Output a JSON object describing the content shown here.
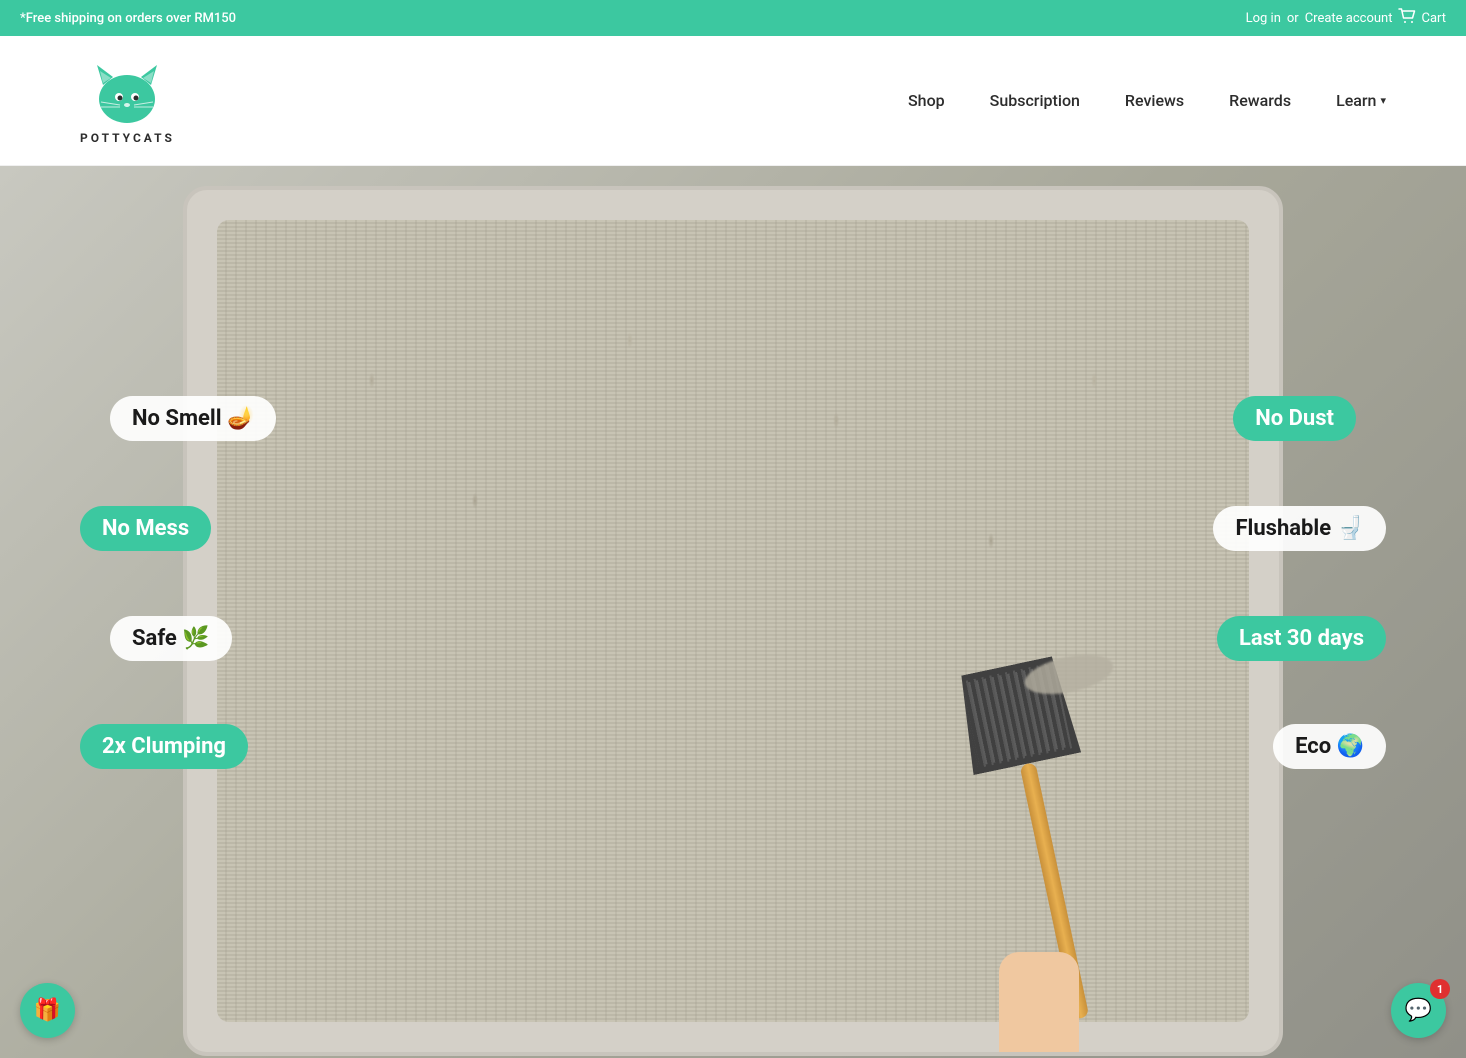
{
  "announcement": {
    "text": "*Free shipping on orders over RM150",
    "login": "Log in",
    "or": "or",
    "create_account": "Create account",
    "cart": "Cart"
  },
  "header": {
    "brand": "POTTYCATS",
    "nav": {
      "shop": "Shop",
      "subscription": "Subscription",
      "reviews": "Reviews",
      "rewards": "Rewards",
      "learn": "Learn"
    }
  },
  "hero": {
    "features": [
      {
        "id": "no-smell",
        "label": "No Smell",
        "emoji": "🪔",
        "style": "white",
        "position": "top-left"
      },
      {
        "id": "no-dust",
        "label": "No Dust",
        "emoji": "",
        "style": "teal",
        "position": "top-right"
      },
      {
        "id": "no-mess",
        "label": "No Mess",
        "emoji": "",
        "style": "teal",
        "position": "mid-left"
      },
      {
        "id": "flushable",
        "label": "Flushable",
        "emoji": "🚽",
        "style": "white",
        "position": "mid-right"
      },
      {
        "id": "safe",
        "label": "Safe",
        "emoji": "🌿",
        "style": "white",
        "position": "lower-left"
      },
      {
        "id": "last30",
        "label": "Last 30 days",
        "emoji": "",
        "style": "teal",
        "position": "lower-right"
      },
      {
        "id": "2xclumping",
        "label": "2x Clumping",
        "emoji": "",
        "style": "teal",
        "position": "bottom-left"
      },
      {
        "id": "eco",
        "label": "Eco",
        "emoji": "🌍",
        "style": "white",
        "position": "bottom-right"
      }
    ]
  },
  "widgets": {
    "rewards_icon": "🎁",
    "chat_icon": "💬",
    "chat_badge": "1"
  },
  "colors": {
    "teal": "#3cc8a0",
    "dark": "#1a1a1a",
    "white": "#ffffff",
    "announcement_bg": "#3cc8a0"
  }
}
